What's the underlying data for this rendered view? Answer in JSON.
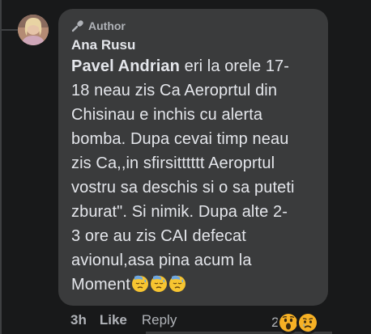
{
  "comment": {
    "badge": "Author",
    "author_name": "Ana Rusu",
    "mention": "Pavel Andrian",
    "text": " eri la orele 17-\n18 neau zis Ca Aeroprtul din\nChisinau e inchis cu alerta\nbomba. Dupa cevai timp neau\nzis Ca,,in sfirsitttttt Aeroprtul\nvostru sa deschis si o sa puteti\nzburat\". Si nimik. Dupa alte 2-\n3 ore au zis CAI defecat\navionul,asa pina acum la\nMoment",
    "trailing_emojis": [
      "downcast-sweat-emoji",
      "downcast-sweat-emoji",
      "downcast-sweat-emoji"
    ]
  },
  "actions": {
    "time": "3h",
    "like": "Like",
    "reply": "Reply"
  },
  "reactions": {
    "count": "2",
    "icons": [
      "wow-reaction-icon",
      "sad-reaction-icon"
    ]
  },
  "colors": {
    "background": "#18191a",
    "bubble": "#3a3b3c",
    "text": "#e4e6eb",
    "secondary_text": "#b0b3b8",
    "reaction_yellow": "#f7b125"
  }
}
